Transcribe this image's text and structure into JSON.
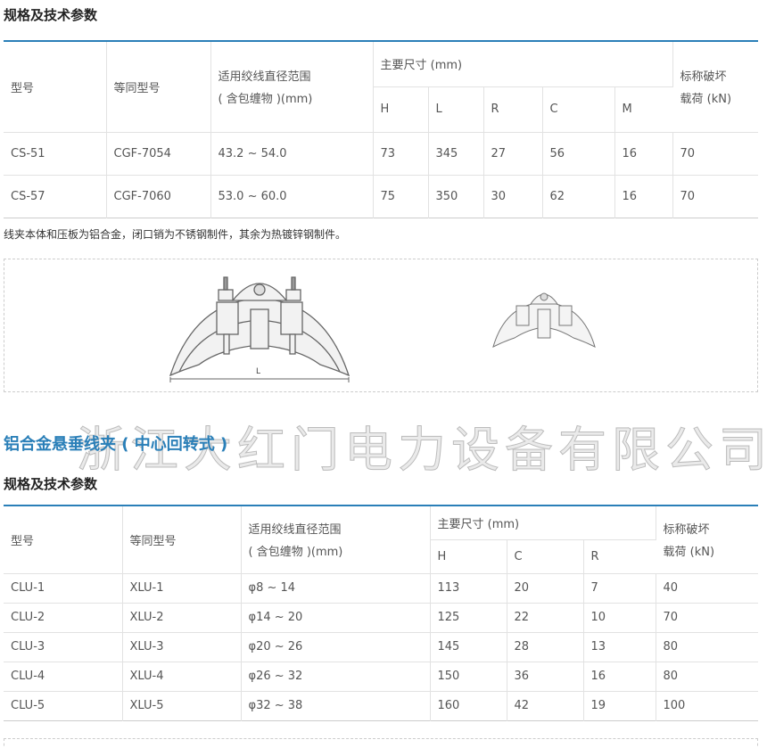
{
  "section1": {
    "heading": "规格及技术参数",
    "headers": {
      "model": "型号",
      "equiv": "等同型号",
      "range_line1": "适用绞线直径范围",
      "range_line2": "( 含包缠物 )(mm)",
      "dims": "主要尺寸 (mm)",
      "load_line1": "标称破坏",
      "load_line2": "载荷 (kN)",
      "sub": [
        "H",
        "L",
        "R",
        "C",
        "M"
      ]
    },
    "rows": [
      [
        "CS-51",
        "CGF-7054",
        "43.2 ~ 54.0",
        "73",
        "345",
        "27",
        "56",
        "16",
        "70"
      ],
      [
        "CS-57",
        "CGF-7060",
        "53.0 ~ 60.0",
        "75",
        "350",
        "30",
        "62",
        "16",
        "70"
      ]
    ],
    "note": "线夹本体和压板为铝合金，闭口销为不锈钢制件，其余为热镀锌钢制件。",
    "figure_dim_label": "L"
  },
  "section2": {
    "title": "铝合金悬垂线夹 ( 中心回转式 )",
    "heading": "规格及技术参数",
    "headers": {
      "model": "型号",
      "equiv": "等同型号",
      "range_line1": "适用绞线直径范围",
      "range_line2": "( 含包缠物 )(mm)",
      "dims": "主要尺寸 (mm)",
      "load_line1": "标称破坏",
      "load_line2": "载荷 (kN)",
      "sub": [
        "H",
        "C",
        "R"
      ]
    },
    "rows": [
      [
        "CLU-1",
        "XLU-1",
        "φ8 ~ 14",
        "113",
        "20",
        "7",
        "40"
      ],
      [
        "CLU-2",
        "XLU-2",
        "φ14 ~ 20",
        "125",
        "22",
        "10",
        "70"
      ],
      [
        "CLU-3",
        "XLU-3",
        "φ20 ~ 26",
        "145",
        "28",
        "13",
        "80"
      ],
      [
        "CLU-4",
        "XLU-4",
        "φ26 ~ 32",
        "150",
        "36",
        "16",
        "80"
      ],
      [
        "CLU-5",
        "XLU-5",
        "φ32 ~ 38",
        "160",
        "42",
        "19",
        "100"
      ]
    ]
  },
  "watermark": "浙江大红门电力设备有限公司"
}
